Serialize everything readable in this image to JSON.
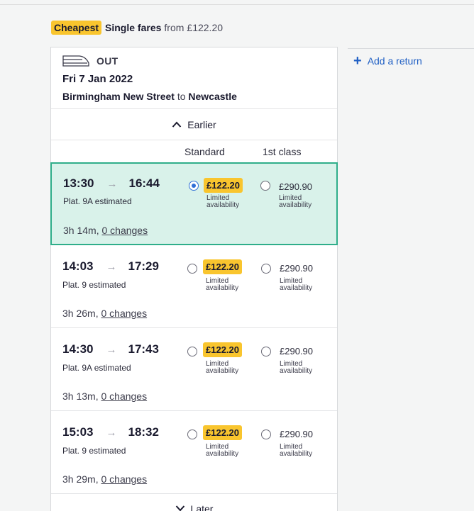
{
  "summary": {
    "badge": "Cheapest",
    "fare_type": "Single fares",
    "from_label": "from",
    "from_price": "£122.20"
  },
  "journey": {
    "direction": "OUT",
    "date": "Fri 7 Jan 2022",
    "origin": "Birmingham New Street",
    "to_word": "to",
    "destination": "Newcastle",
    "earlier_label": "Earlier",
    "later_label": "Later",
    "class_headers": {
      "standard": "Standard",
      "first": "1st class"
    },
    "services": [
      {
        "depart": "13:30",
        "arrive": "16:44",
        "platform": "Plat. 9A estimated",
        "duration": "3h 14m,",
        "changes": "0 changes",
        "std_price": "£122.20",
        "std_avail": [
          "Limited",
          "availability"
        ],
        "fc_price": "£290.90",
        "fc_avail": [
          "Limited",
          "availability"
        ],
        "selected": true
      },
      {
        "depart": "14:03",
        "arrive": "17:29",
        "platform": "Plat. 9 estimated",
        "duration": "3h 26m,",
        "changes": "0 changes",
        "std_price": "£122.20",
        "std_avail": [
          "Limited",
          "availability"
        ],
        "fc_price": "£290.90",
        "fc_avail": [
          "Limited",
          "availability"
        ],
        "selected": false
      },
      {
        "depart": "14:30",
        "arrive": "17:43",
        "platform": "Plat. 9A estimated",
        "duration": "3h 13m,",
        "changes": "0 changes",
        "std_price": "£122.20",
        "std_avail": [
          "Limited",
          "availability"
        ],
        "fc_price": "£290.90",
        "fc_avail": [
          "Limited",
          "availability"
        ],
        "selected": false
      },
      {
        "depart": "15:03",
        "arrive": "18:32",
        "platform": "Plat. 9 estimated",
        "duration": "3h 29m,",
        "changes": "0 changes",
        "std_price": "£122.20",
        "std_avail": [
          "Limited",
          "availability"
        ],
        "fc_price": "£290.90",
        "fc_avail": [
          "Limited",
          "availability"
        ],
        "selected": false
      }
    ]
  },
  "add_return": {
    "label": "Add a return",
    "icon": "plus-icon"
  },
  "colors": {
    "accent_yellow": "#f9c52e",
    "selected_bg": "#d9f2ea",
    "selected_border": "#2fae8a",
    "link_blue": "#1f5fc4",
    "radio_blue": "#2e6ed6"
  }
}
